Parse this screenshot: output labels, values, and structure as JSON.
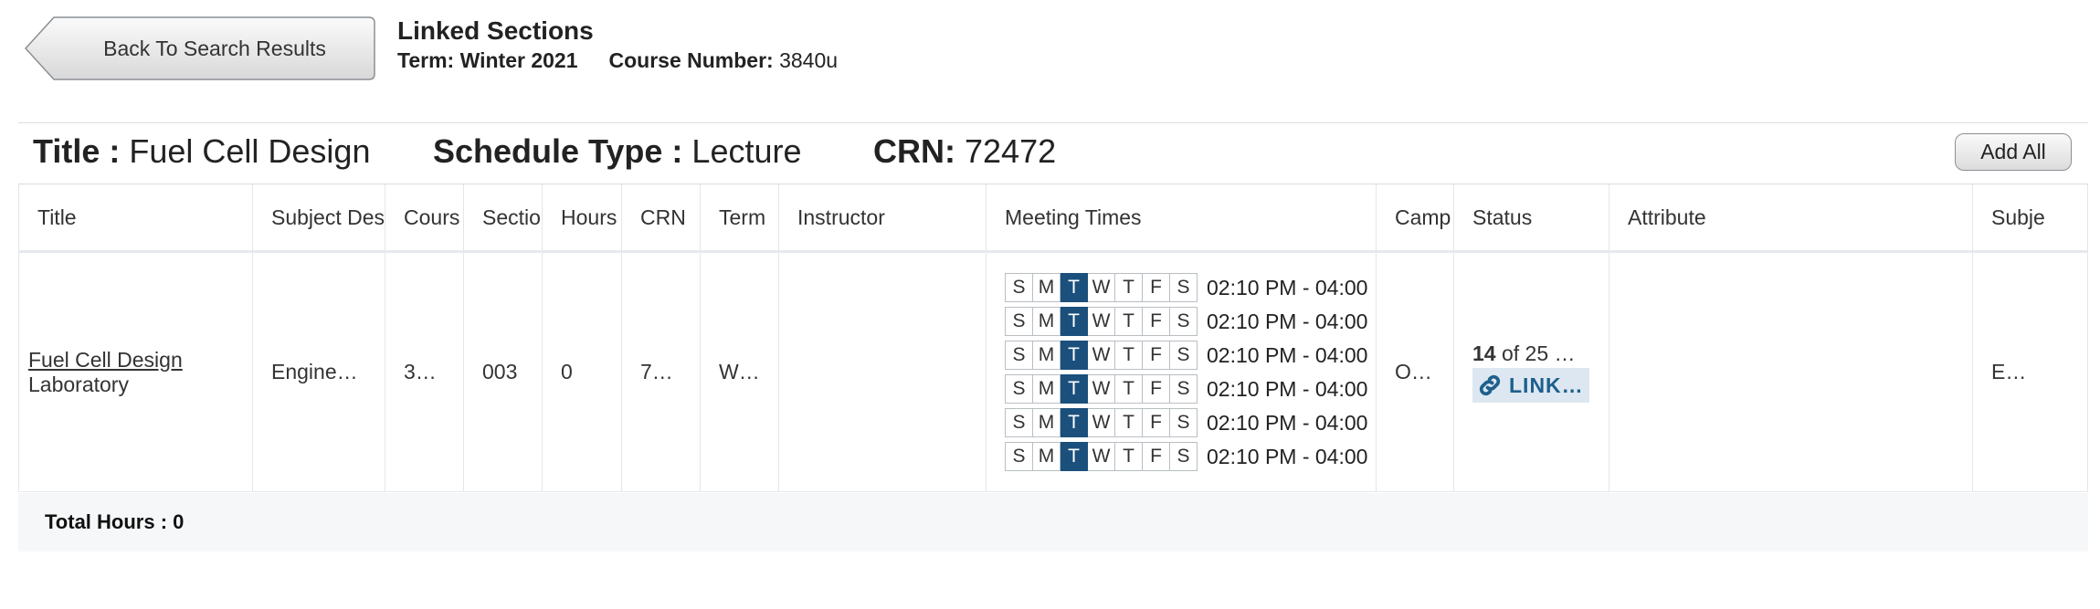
{
  "header": {
    "back_label": "Back To Search Results",
    "title": "Linked Sections",
    "term_label": "Term:",
    "term_value": "Winter 2021",
    "course_number_label": "Course Number:",
    "course_number_value": "3840u"
  },
  "section": {
    "title_label": "Title :",
    "title_value": "Fuel Cell Design",
    "schedule_type_label": "Schedule Type :",
    "schedule_type_value": "Lecture",
    "crn_label": "CRN:",
    "crn_value": "72472",
    "add_all_label": "Add All"
  },
  "table": {
    "columns": [
      "Title",
      "Subject Des",
      "Cours",
      "Sectio",
      "Hours",
      "CRN",
      "Term",
      "Instructor",
      "Meeting Times",
      "Camp",
      "Status",
      "Attribute",
      "Subje"
    ],
    "row": {
      "title_link": "Fuel Cell Design",
      "title_sub": "Laboratory",
      "subject": "Engine…",
      "course": "3…",
      "section": "003",
      "hours": "0",
      "crn": "7…",
      "term": "W…",
      "instructor": "",
      "meetings": [
        {
          "days": [
            "S",
            "M",
            "T",
            "W",
            "T",
            "F",
            "S"
          ],
          "active_index": 2,
          "time": "02:10 PM - 04:00"
        },
        {
          "days": [
            "S",
            "M",
            "T",
            "W",
            "T",
            "F",
            "S"
          ],
          "active_index": 2,
          "time": "02:10 PM - 04:00"
        },
        {
          "days": [
            "S",
            "M",
            "T",
            "W",
            "T",
            "F",
            "S"
          ],
          "active_index": 2,
          "time": "02:10 PM - 04:00"
        },
        {
          "days": [
            "S",
            "M",
            "T",
            "W",
            "T",
            "F",
            "S"
          ],
          "active_index": 2,
          "time": "02:10 PM - 04:00"
        },
        {
          "days": [
            "S",
            "M",
            "T",
            "W",
            "T",
            "F",
            "S"
          ],
          "active_index": 2,
          "time": "02:10 PM - 04:00"
        },
        {
          "days": [
            "S",
            "M",
            "T",
            "W",
            "T",
            "F",
            "S"
          ],
          "active_index": 2,
          "time": "02:10 PM - 04:00"
        }
      ],
      "campus": "O…",
      "status_seats": "14",
      "status_rest": " of 25 …",
      "status_link": "LINK…",
      "attribute": "",
      "subject_code": "E…"
    }
  },
  "totals": {
    "label": "Total Hours : 0"
  },
  "colors": {
    "active_day": "#1b4f7c",
    "link_badge_bg": "#dce7f1",
    "link_text": "#1e5f8c"
  },
  "icons": {
    "back": "arrow-left-shape",
    "link": "link-chain-icon"
  }
}
